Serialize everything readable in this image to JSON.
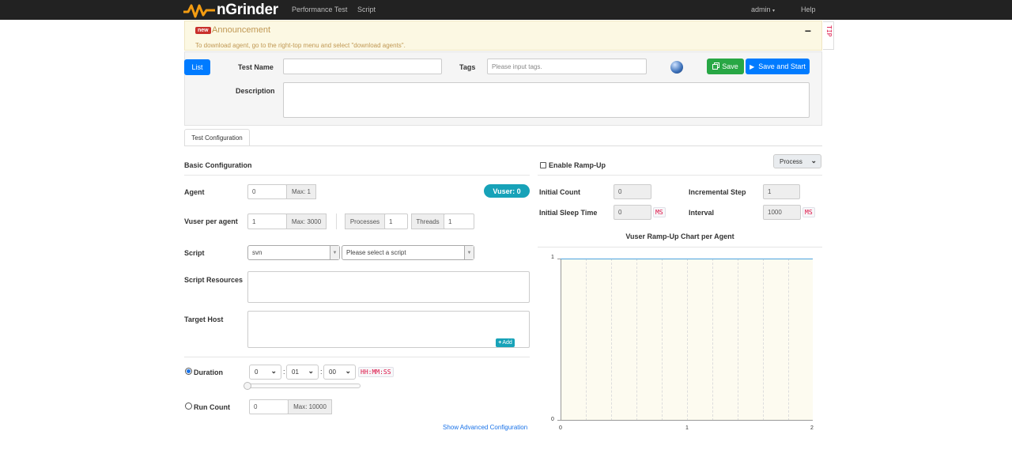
{
  "navbar": {
    "brand": "nGrinder",
    "links": [
      "Performance Test",
      "Script"
    ],
    "user_menu": "admin",
    "help": "Help"
  },
  "announcement": {
    "badge": "new",
    "title": "Announcement",
    "collapse": "−",
    "text": "To download agent, go to the right-top menu and select \"download agents\".",
    "tip": "TIP"
  },
  "test_form": {
    "list_button": "List",
    "test_name_label": "Test Name",
    "test_name_value": "",
    "tags_label": "Tags",
    "tags_placeholder": "Please input tags.",
    "save_button": "Save",
    "save_start_button": "Save and Start",
    "description_label": "Description",
    "description_value": ""
  },
  "tabs": [
    "Test Configuration"
  ],
  "basic": {
    "heading": "Basic Configuration",
    "agent_label": "Agent",
    "agent_value": "0",
    "agent_max": "Max: 1",
    "vuser_badge": "Vuser: 0",
    "vuser_per_agent_label": "Vuser per agent",
    "vuser_per_agent_value": "1",
    "vuser_max": "Max: 3000",
    "processes_label": "Processes",
    "processes_value": "1",
    "threads_label": "Threads",
    "threads_value": "1",
    "script_label": "Script",
    "script_repo": "svn",
    "script_placeholder": "Please select a script",
    "script_resources_label": "Script Resources",
    "target_host_label": "Target Host",
    "add_button": "Add",
    "duration_label": "Duration",
    "duration_selected": true,
    "duration_hours": "0",
    "duration_minutes": "01",
    "duration_seconds": "00",
    "duration_format": "HH:MM:SS",
    "duration_slider_fraction": 0,
    "run_count_label": "Run Count",
    "run_count_value": "0",
    "run_count_max": "Max: 10000",
    "advanced_link": "Show Advanced Configuration"
  },
  "rampup": {
    "enable_label": "Enable Ramp-Up",
    "enabled": false,
    "type": "Process",
    "initial_count_label": "Initial Count",
    "initial_count_value": "0",
    "incremental_step_label": "Incremental Step",
    "incremental_step_value": "1",
    "initial_sleep_label": "Initial Sleep Time",
    "initial_sleep_value": "0",
    "interval_label": "Interval",
    "interval_value": "1000",
    "ms_unit": "MS"
  },
  "chart_data": {
    "type": "line",
    "title": "Vuser Ramp-Up Chart per Agent",
    "x_ticks": [
      "0",
      "1",
      "2"
    ],
    "y_ticks": [
      "0",
      "1"
    ],
    "xlim": [
      0,
      2
    ],
    "ylim": [
      0,
      1
    ],
    "series": [
      {
        "x": [
          0,
          2
        ],
        "y": [
          1,
          1
        ]
      }
    ],
    "colors": {
      "line": "#4aa3df",
      "plot_bg": "#fdfbf0"
    }
  },
  "colors": {
    "primary": "#007bff",
    "success": "#28a745",
    "info": "#17a2b8",
    "danger": "#c9302c"
  }
}
